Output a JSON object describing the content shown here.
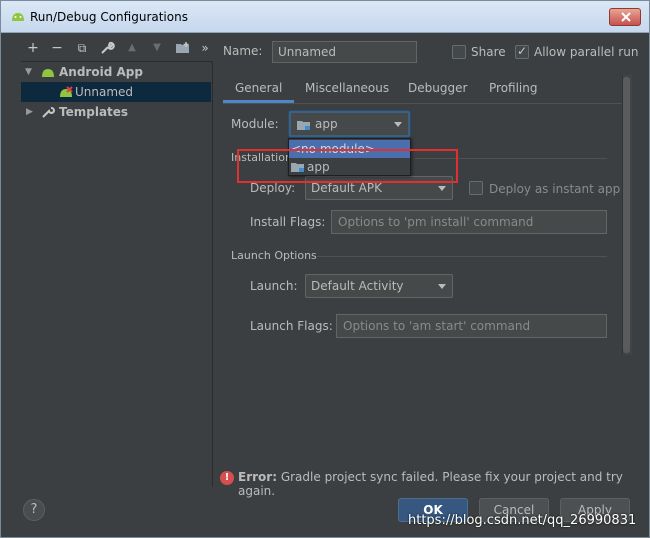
{
  "window": {
    "title": "Run/Debug Configurations"
  },
  "toolbar": {
    "add": "+",
    "remove": "−",
    "copy": "⧉",
    "edit": "🔧",
    "up": "▲",
    "down": "▼",
    "folder": "📁",
    "more": "»"
  },
  "tree": {
    "android_app": "Android App",
    "unnamed": "Unnamed",
    "templates": "Templates"
  },
  "name": {
    "label": "Name:",
    "value": "Unnamed"
  },
  "share": {
    "label": "Share",
    "checked": false
  },
  "parallel": {
    "label": "Allow parallel run",
    "checked": true
  },
  "tabs": [
    "General",
    "Miscellaneous",
    "Debugger",
    "Profiling"
  ],
  "module": {
    "label": "Module:",
    "value": "app"
  },
  "dropdown": {
    "items": [
      "<no module>",
      "app"
    ],
    "selected_index": 0
  },
  "installation": {
    "title": "Installation",
    "deploy_label": "Deploy:",
    "deploy_value": "Default APK",
    "instant_label": "Deploy as instant app",
    "flags_label": "Install Flags:",
    "flags_placeholder": "Options to 'pm install' command"
  },
  "launch": {
    "title": "Launch Options",
    "launch_label": "Launch:",
    "launch_value": "Default Activity",
    "flags_label": "Launch Flags:",
    "flags_placeholder": "Options to 'am start' command"
  },
  "error": {
    "prefix": "Error:",
    "message": "Gradle project sync failed. Please fix your project and try again."
  },
  "buttons": {
    "help": "?",
    "ok": "OK",
    "cancel": "Cancel",
    "apply": "Apply"
  },
  "watermark": "https://blog.csdn.net/qq_26990831",
  "colors": {
    "accent": "#4a88c7",
    "selection": "#4b6eaf",
    "error": "#d64f4f",
    "highlight": "#e03131"
  }
}
